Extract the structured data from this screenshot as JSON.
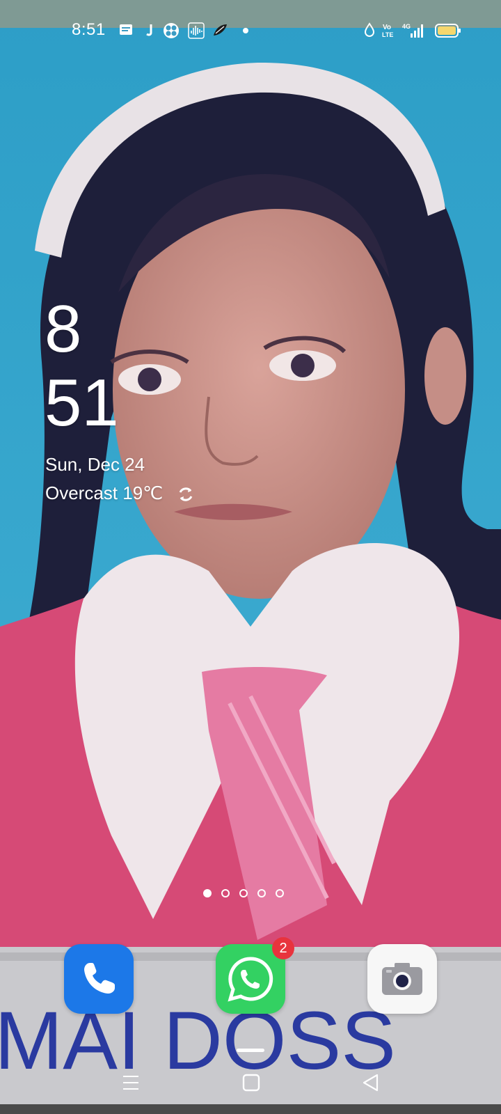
{
  "status_bar": {
    "time": "8:51",
    "left_icons": [
      "message-icon",
      "j-app-icon",
      "fan-icon",
      "sound-wave-icon",
      "feather-icon",
      "dot-icon"
    ],
    "right_icons": [
      "data-saver-icon",
      "volte-icon",
      "signal-4g-icon",
      "battery-icon"
    ],
    "volte_label": "Vo\nLTE",
    "network_label": "4G"
  },
  "clock": {
    "hour": "8",
    "minute": "51",
    "date": "Sun, Dec 24",
    "weather": "Overcast 19℃"
  },
  "pages": {
    "count": 5,
    "active": 0
  },
  "dock": {
    "apps": [
      {
        "name": "Phone",
        "icon": "phone-icon",
        "color": "#1c78e8"
      },
      {
        "name": "WhatsApp",
        "icon": "whatsapp-icon",
        "color": "#33d162",
        "badge": "2"
      },
      {
        "name": "Camera",
        "icon": "camera-icon",
        "color": "#f7f7f7"
      }
    ]
  },
  "wallpaper": {
    "text": "MAI DOSS"
  },
  "colors": {
    "accent_badge": "#e8333d",
    "battery": "#f5d76e"
  }
}
